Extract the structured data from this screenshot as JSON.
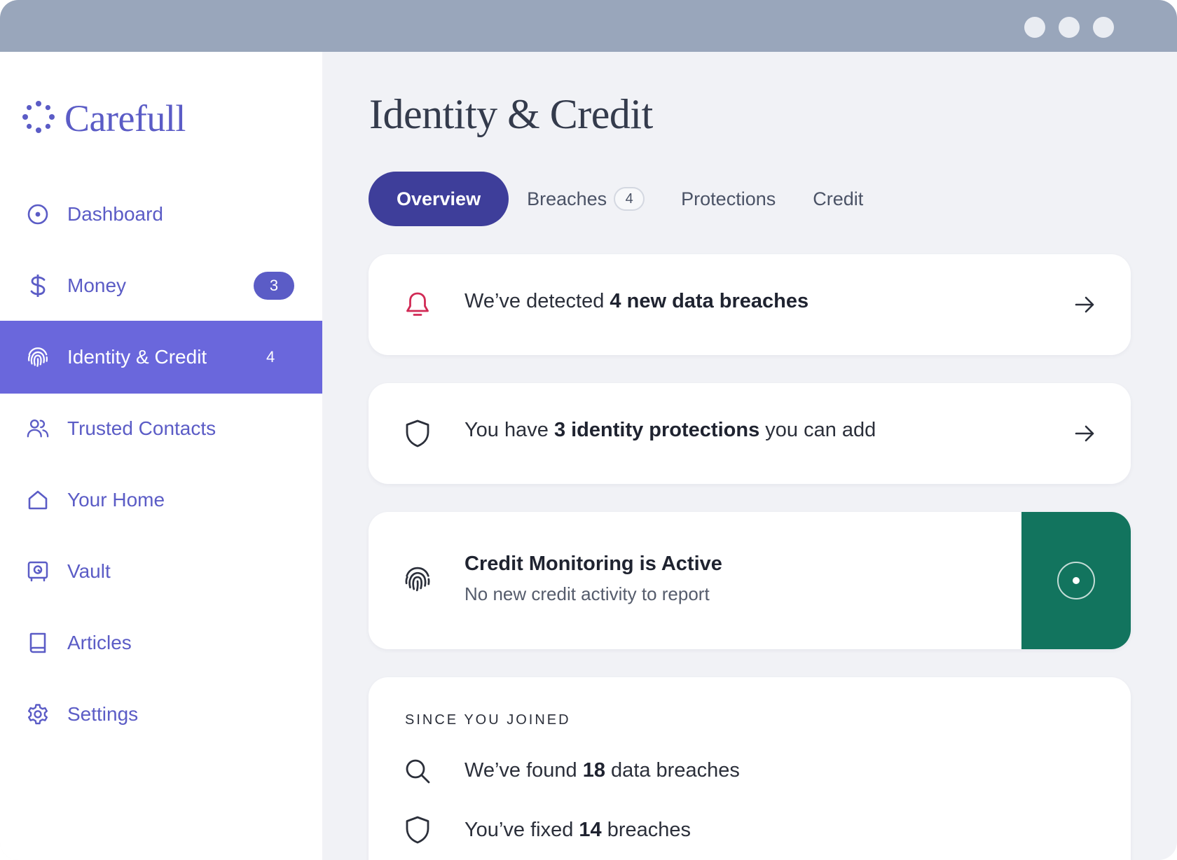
{
  "window": {
    "controls": [
      "window-dot-1",
      "window-dot-2",
      "window-dot-3"
    ]
  },
  "brand": {
    "name": "Carefull",
    "color": "#5b5cc6"
  },
  "sidebar": {
    "items": [
      {
        "label": "Dashboard",
        "icon": "dashboard-icon"
      },
      {
        "label": "Money",
        "icon": "dollar-icon",
        "badge": "3"
      },
      {
        "label": "Identity & Credit",
        "icon": "fingerprint-icon",
        "count": "4",
        "active": true
      },
      {
        "label": "Trusted Contacts",
        "icon": "contacts-icon"
      },
      {
        "label": "Your Home",
        "icon": "home-icon"
      },
      {
        "label": "Vault",
        "icon": "vault-icon"
      },
      {
        "label": "Articles",
        "icon": "book-icon"
      },
      {
        "label": "Settings",
        "icon": "gear-icon"
      }
    ]
  },
  "main": {
    "title": "Identity & Credit",
    "tabs": [
      {
        "label": "Overview",
        "active": true
      },
      {
        "label": "Breaches",
        "badge": "4"
      },
      {
        "label": "Protections"
      },
      {
        "label": "Credit"
      }
    ],
    "breach_alert": {
      "pre": "We’ve detected ",
      "bold": "4 new data breaches",
      "post": ""
    },
    "protections_alert": {
      "pre": "You have ",
      "bold": "3 identity protections",
      "post": " you can add"
    },
    "monitoring": {
      "title": "Credit Monitoring is Active",
      "subtitle": "No new credit activity to report",
      "panel_color": "#12745e"
    },
    "since_joined": {
      "label": "SINCE YOU JOINED",
      "rows": [
        {
          "icon": "search-icon",
          "pre": "We’ve found ",
          "bold": "18",
          "post": " data breaches"
        },
        {
          "icon": "shield-icon",
          "pre": "You’ve fixed ",
          "bold": "14",
          "post": " breaches"
        }
      ]
    }
  },
  "colors": {
    "accent": "#5b5cc6",
    "active_nav": "#6a67dc",
    "active_tab": "#3e3e9a",
    "alert_red": "#d12a55",
    "titlebar": "#99a6bb"
  }
}
